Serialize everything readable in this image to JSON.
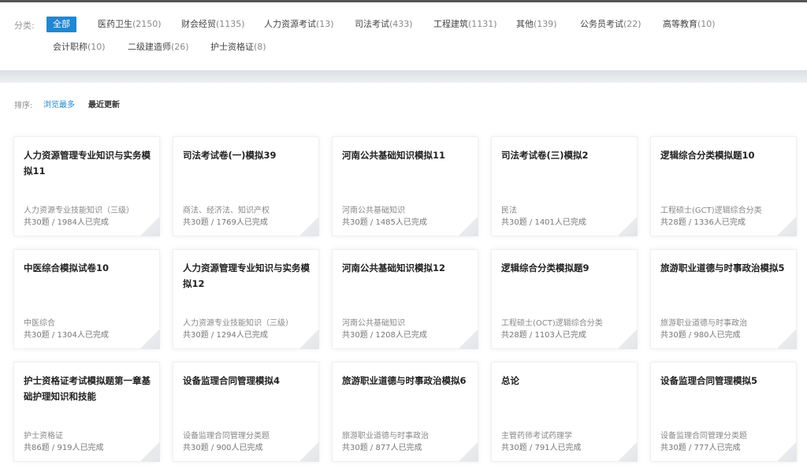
{
  "filter": {
    "label": "分类:",
    "categories": [
      {
        "name": "全部",
        "count": ""
      },
      {
        "name": "医药卫生",
        "count": "(2150)"
      },
      {
        "name": "财会经贸",
        "count": "(1135)"
      },
      {
        "name": "人力资源考试",
        "count": "(13)"
      },
      {
        "name": "司法考试",
        "count": "(433)"
      },
      {
        "name": "工程建筑",
        "count": "(1131)"
      },
      {
        "name": "其他",
        "count": "(139)"
      },
      {
        "name": "公务员考试",
        "count": "(22)"
      },
      {
        "name": "高等教育",
        "count": "(10)"
      },
      {
        "name": "会计职称",
        "count": "(10)"
      },
      {
        "name": "二级建造师",
        "count": "(26)"
      },
      {
        "name": "护士资格证",
        "count": "(8)"
      }
    ]
  },
  "sort": {
    "label": "排序:",
    "options": [
      "浏览最多",
      "最近更新"
    ]
  },
  "cards": [
    {
      "title": "人力资源管理专业知识与实务模拟11",
      "subject": "人力资源专业技能知识（三级）",
      "meta": "共30题 / 1984人已完成"
    },
    {
      "title": "司法考试卷(一)模拟39",
      "subject": "商法、经济法、知识产权",
      "meta": "共30题 / 1769人已完成"
    },
    {
      "title": "河南公共基础知识模拟11",
      "subject": "河南公共基础知识",
      "meta": "共30题 / 1485人已完成"
    },
    {
      "title": "司法考试卷(三)模拟2",
      "subject": "民法",
      "meta": "共30题 / 1401人已完成"
    },
    {
      "title": "逻辑综合分类模拟题10",
      "subject": "工程硕士(GCT)逻辑综合分类",
      "meta": "共28题 / 1336人已完成"
    },
    {
      "title": "中医综合模拟试卷10",
      "subject": "中医综合",
      "meta": "共30题 / 1304人已完成"
    },
    {
      "title": "人力资源管理专业知识与实务模拟12",
      "subject": "人力资源专业技能知识（三级）",
      "meta": "共30题 / 1294人已完成"
    },
    {
      "title": "河南公共基础知识模拟12",
      "subject": "河南公共基础知识",
      "meta": "共30题 / 1208人已完成"
    },
    {
      "title": "逻辑综合分类模拟题9",
      "subject": "工程硕士(OCT)逻辑综合分类",
      "meta": "共28题 / 1103人已完成"
    },
    {
      "title": "旅游职业道德与时事政治模拟5",
      "subject": "旅游职业道德与时事政治",
      "meta": "共30题 / 980人已完成"
    },
    {
      "title": "护士资格证考试模拟题第一章基础护理知识和技能",
      "subject": "护士资格证",
      "meta": "共86题 / 919人已完成"
    },
    {
      "title": "设备监理合同管理模拟4",
      "subject": "设备监理合同管理分类题",
      "meta": "共30题 / 900人已完成"
    },
    {
      "title": "旅游职业道德与时事政治模拟6",
      "subject": "旅游职业道德与时事政治",
      "meta": "共30题 / 877人已完成"
    },
    {
      "title": "总论",
      "subject": "主管药师考试药理学",
      "meta": "共30题 / 791人已完成"
    },
    {
      "title": "设备监理合同管理模拟5",
      "subject": "设备监理合同管理分类题",
      "meta": "共30题 / 777人已完成"
    }
  ],
  "colors": {
    "accent": "#1e88d2",
    "band": "#dcdfe3"
  }
}
